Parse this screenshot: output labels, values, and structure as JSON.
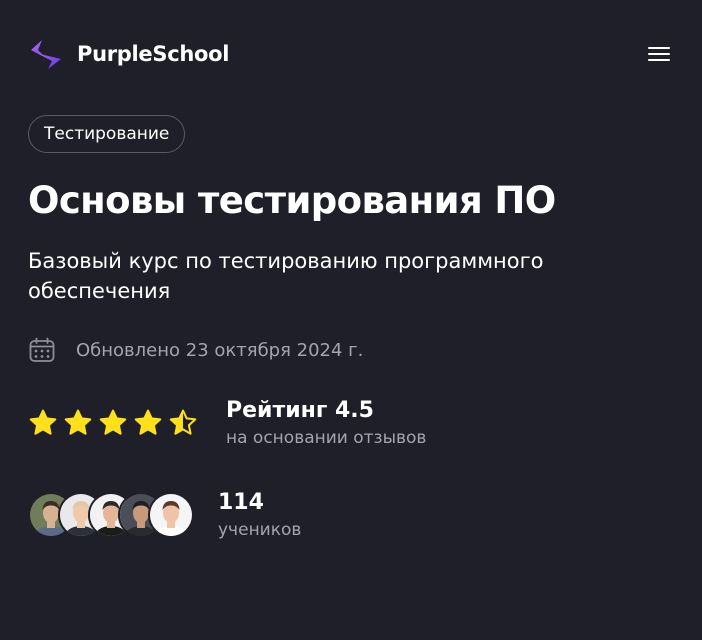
{
  "header": {
    "logo_icon": "purpleschool-chevron-logo",
    "brand": "PurpleSchool",
    "menu_icon": "hamburger-menu-icon"
  },
  "course": {
    "tag": "Тестирование",
    "title": "Основы тестирования ПО",
    "subtitle": "Базовый курс по тестированию программного обеспечения",
    "updated": "Обновлено 23 октября 2024 г."
  },
  "rating": {
    "value": 4.5,
    "max": 5,
    "label": "Рейтинг 4.5",
    "note": "на основании отзывов",
    "star_color": "#ffe01b"
  },
  "students": {
    "count": "114",
    "label": "учеников",
    "avatars": [
      "student-avatar-1",
      "student-avatar-2",
      "student-avatar-3",
      "student-avatar-4",
      "student-avatar-5"
    ]
  },
  "colors": {
    "background": "#1e1f28",
    "text": "#ffffff",
    "muted": "#a3a4ad",
    "brand_gradient": [
      "#b155f5",
      "#6e45f0"
    ]
  }
}
